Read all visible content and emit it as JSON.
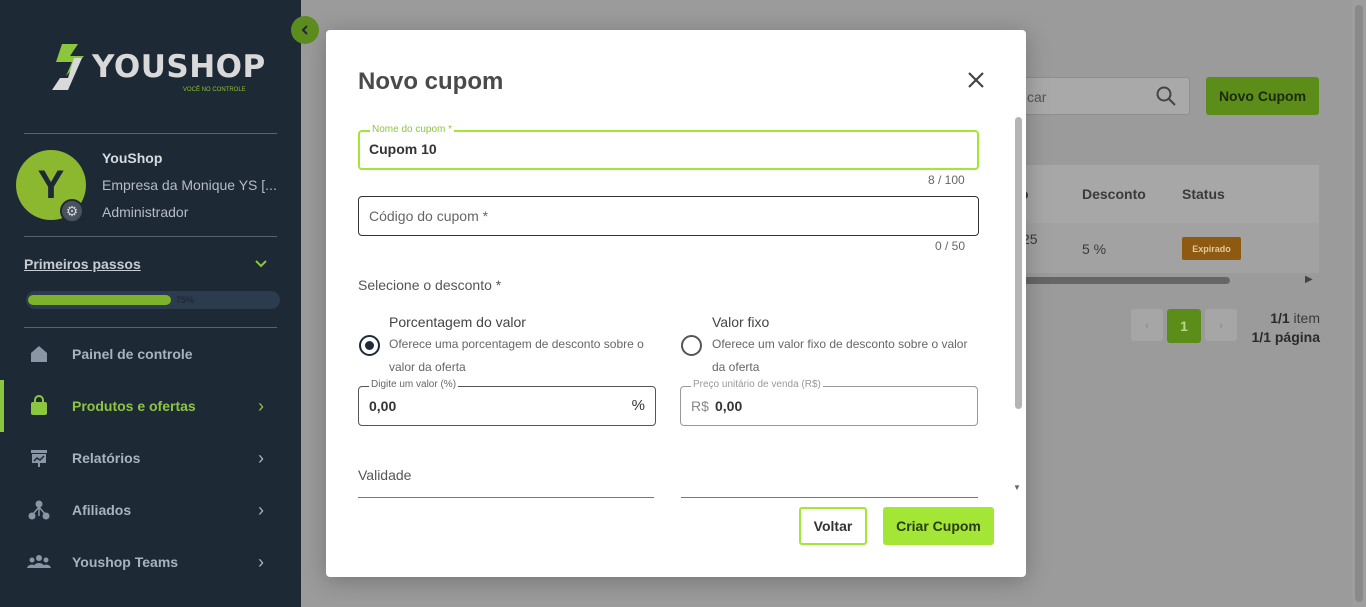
{
  "sidebar": {
    "logo_text": "YOUSHOP",
    "logo_tagline": "VOCÊ NO CONTROLE",
    "collapse_icon": "chevron-left-icon",
    "user": {
      "avatar_letter": "Y",
      "name": "YouShop",
      "company": "Empresa da Monique YS [...",
      "role": "Administrador"
    },
    "first_steps": {
      "label": "Primeiros passos",
      "progress": 0.75,
      "progress_label": "75%"
    },
    "nav": [
      {
        "label": "Painel de controle",
        "icon": "home-icon",
        "active": false,
        "has_children": false
      },
      {
        "label": "Produtos e ofertas",
        "icon": "shopping-bag-icon",
        "active": true,
        "has_children": true
      },
      {
        "label": "Relatórios",
        "icon": "chart-board-icon",
        "active": false,
        "has_children": true
      },
      {
        "label": "Afiliados",
        "icon": "network-icon",
        "active": false,
        "has_children": true
      },
      {
        "label": "Youshop Teams",
        "icon": "team-icon",
        "active": false,
        "has_children": true
      }
    ]
  },
  "background": {
    "search_placeholder_visible": "car",
    "new_coupon_label": "Novo Cupom",
    "table": {
      "headers": [
        "Desconto",
        "Status"
      ],
      "header_fragment": "o",
      "row": {
        "fragment": "25",
        "discount": "5 %",
        "status": "Expirado"
      }
    },
    "pagination": {
      "current": "1",
      "items_count": "1/1",
      "items_label": "item",
      "pages_count": "1/1",
      "pages_label": "página"
    }
  },
  "modal": {
    "title": "Novo cupom",
    "coupon_name": {
      "label": "Nome do cupom *",
      "value": "Cupom 10",
      "counter": "8 / 100"
    },
    "coupon_code": {
      "placeholder": "Código do cupom *",
      "counter": "0 / 50"
    },
    "discount_section_label": "Selecione o desconto *",
    "options": [
      {
        "title": "Porcentagem do valor",
        "description": "Oferece uma porcentagem de desconto sobre o valor da oferta",
        "checked": true
      },
      {
        "title": "Valor fixo",
        "description": "Oferece um valor fixo de desconto sobre o valor da oferta",
        "checked": false
      }
    ],
    "percent_field": {
      "label": "Digite um valor (%)",
      "value": "0,00",
      "suffix": "%"
    },
    "fixed_field": {
      "label": "Preço unitário de venda (R$)",
      "prefix": "R$",
      "value": "0,00"
    },
    "validity_label": "Validade",
    "back_label": "Voltar",
    "create_label": "Criar Cupom"
  },
  "colors": {
    "sidebar_bg": "#1e2936",
    "accent_green": "#a3e635",
    "brand_green": "#8cc63f",
    "overlay_bg": "#9b9b9b",
    "expired_badge": "#8e5a12"
  }
}
